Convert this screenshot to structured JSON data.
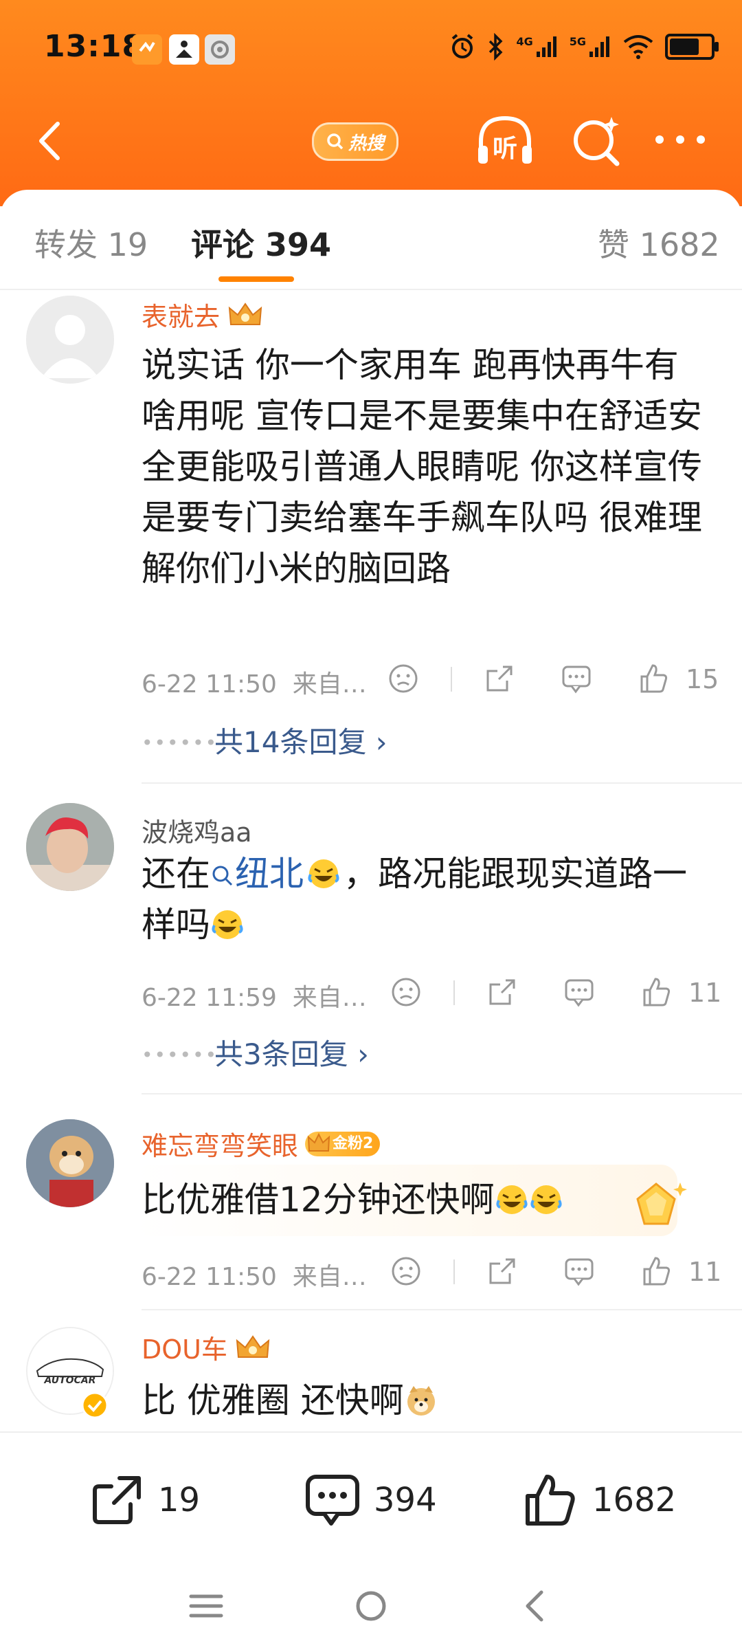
{
  "status_bar": {
    "time": "13:18",
    "network_1": "4G",
    "network_2": "5G",
    "battery_level": 0.8
  },
  "nav": {
    "hot_search_label": "热搜",
    "listen_label": "听"
  },
  "tabs": {
    "repost": "转发 19",
    "comment": "评论 394",
    "like": "赞 1682"
  },
  "comments": [
    {
      "user": "表就去",
      "text": "说实话 你一个家用车 跑再快再牛有啥用呢 宣传口是不是要集中在舒适安全更能吸引普通人眼睛呢 你这样宣传是要专门卖给塞车手飙车队吗 很难理解你们小米的脑回路",
      "time": "6-22 11:50",
      "source": "来自…",
      "likes": "15",
      "replies": "共14条回复 ›"
    },
    {
      "user": "波烧鸡aa",
      "text_prefix": "还在",
      "link": "纽北",
      "text_suffix": "，路况能跟现实道路一样吗",
      "time": "6-22 11:59",
      "source": "来自…",
      "likes": "11",
      "replies": "共3条回复 ›"
    },
    {
      "user": "难忘弯弯笑眼",
      "fan_badge": "金粉2",
      "text": "比优雅借12分钟还快啊",
      "time": "6-22 11:50",
      "source": "来自…",
      "likes": "11"
    },
    {
      "user": "DOU车",
      "avatar_text": "AUTOCAR",
      "text": "比 优雅圈 还快啊"
    }
  ],
  "bottom_bar": {
    "repost_count": "19",
    "comment_count": "394",
    "like_count": "1682"
  },
  "colors": {
    "header_orange": "#ff7a1a",
    "accent": "#ff8200",
    "vip_name": "#e8632c",
    "link": "#2b62b0"
  }
}
